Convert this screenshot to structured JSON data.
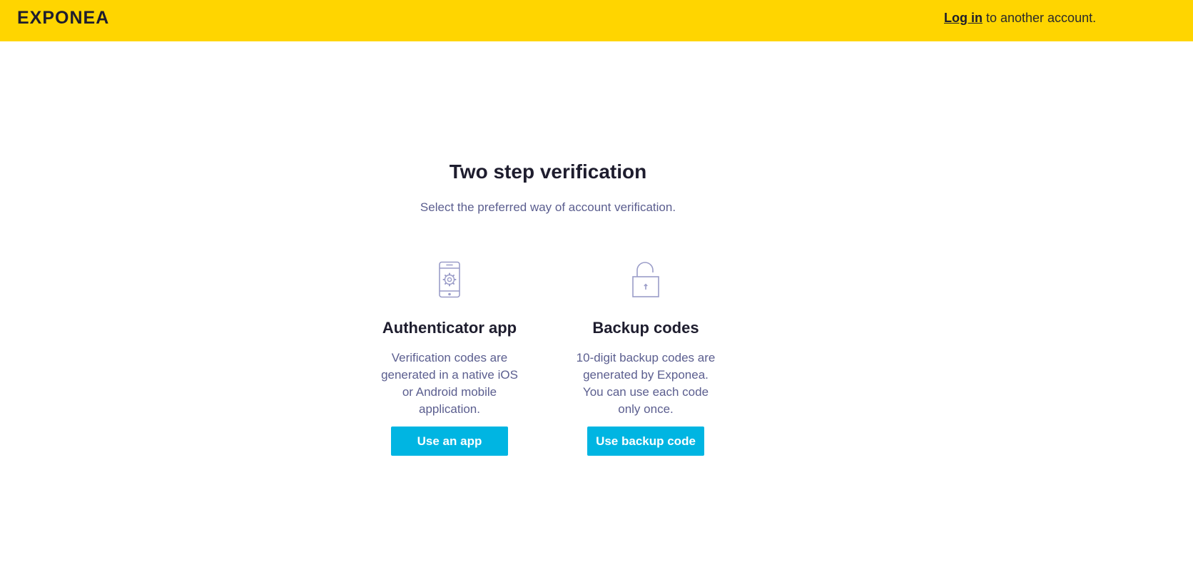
{
  "header": {
    "logo_text": "EXPONEA",
    "login_link": "Log in",
    "login_suffix": " to another account."
  },
  "main": {
    "title": "Two step verification",
    "subtitle": "Select the preferred way of account verification.",
    "options": [
      {
        "icon": "smartphone-gear-icon",
        "title": "Authenticator app",
        "description": "Verification codes are generated in a native iOS or Android mobile application.",
        "button_label": "Use an app"
      },
      {
        "icon": "open-padlock-icon",
        "title": "Backup codes",
        "description": "10-digit backup codes are generated by Exponea. You can use each code only once.",
        "button_label": "Use backup code"
      }
    ]
  },
  "colors": {
    "header_bg": "#FFD500",
    "button_bg": "#00B5E2",
    "heading": "#1E1D2E",
    "body_text": "#5B5E8F",
    "icon_stroke": "#9A9CC8"
  }
}
